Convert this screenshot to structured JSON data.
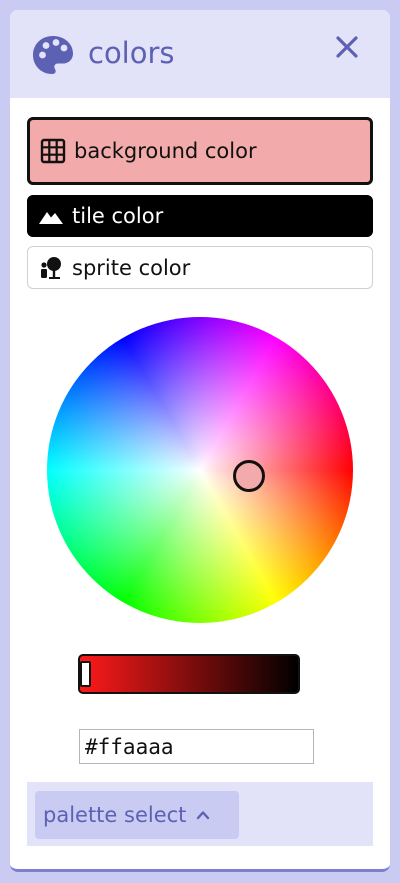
{
  "header": {
    "title": "colors",
    "icon": "palette-icon",
    "close_icon": "close-icon"
  },
  "options": [
    {
      "label": "background color",
      "icon": "grid-icon",
      "selected": true,
      "swatch": "#f2aaaa"
    },
    {
      "label": "tile color",
      "icon": "mountain-icon",
      "selected": false,
      "swatch": "#000000"
    },
    {
      "label": "sprite color",
      "icon": "person-tree-icon",
      "selected": false,
      "swatch": "#ffffff"
    }
  ],
  "picker": {
    "hex_value": "#ffaaaa",
    "brightness": 0.0,
    "selected_color": "#f2aaaa"
  },
  "footer": {
    "palette_label": "palette select",
    "palette_icon": "chevron-up-icon"
  },
  "colors": {
    "accent": "#5d61b4",
    "header_bg": "#e2e3f8",
    "button_bg": "#c9cbf2"
  }
}
